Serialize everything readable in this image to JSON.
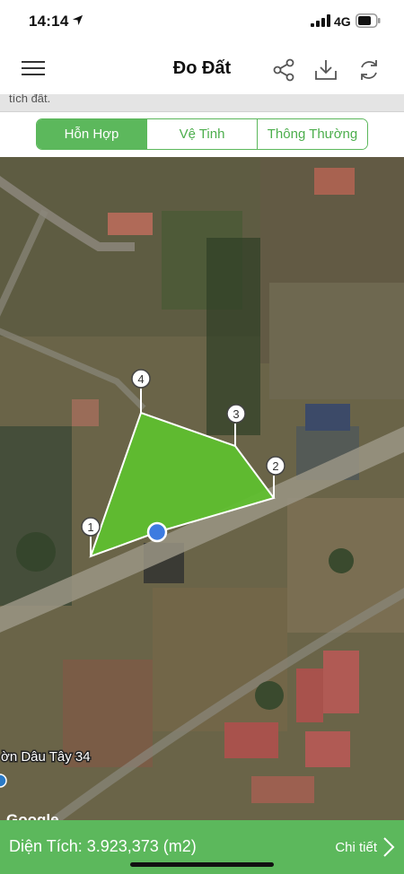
{
  "status_bar": {
    "time": "14:14",
    "network": "4G"
  },
  "header": {
    "title": "Đo Đất",
    "icons": [
      "menu-icon",
      "share-icon",
      "download-icon",
      "refresh-icon"
    ]
  },
  "info_strip": {
    "text": "tích đất."
  },
  "map_types": {
    "hybrid": "Hỗn Hợp",
    "satellite": "Vệ Tinh",
    "normal": "Thông Thường",
    "selected": "Hỗn Hợp"
  },
  "map": {
    "polygon_fill": "#5fbf2f",
    "markers": [
      "1",
      "2",
      "3",
      "4"
    ],
    "place_label": "ờn Dâu Tây 34",
    "attribution": "Google"
  },
  "bottom_bar": {
    "area_text": "Diện Tích: 3.923,373 (m2)",
    "detail_label": "Chi tiết"
  },
  "colors": {
    "accent": "#5cb85c",
    "location_dot": "#3d7be0"
  }
}
